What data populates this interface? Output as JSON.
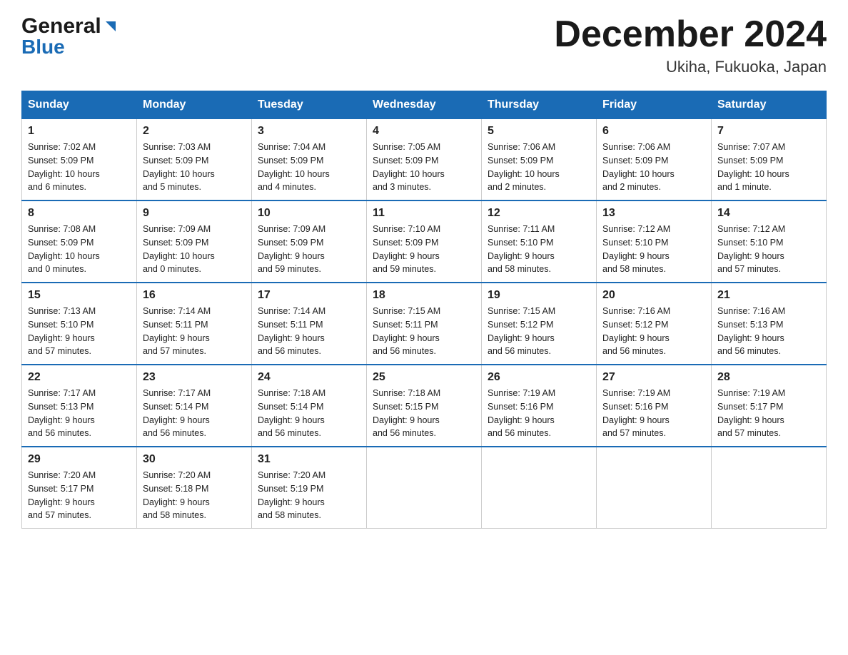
{
  "header": {
    "logo_line1": "General",
    "logo_line2": "Blue",
    "title": "December 2024",
    "subtitle": "Ukiha, Fukuoka, Japan"
  },
  "columns": [
    "Sunday",
    "Monday",
    "Tuesday",
    "Wednesday",
    "Thursday",
    "Friday",
    "Saturday"
  ],
  "weeks": [
    [
      {
        "day": "1",
        "info": "Sunrise: 7:02 AM\nSunset: 5:09 PM\nDaylight: 10 hours\nand 6 minutes."
      },
      {
        "day": "2",
        "info": "Sunrise: 7:03 AM\nSunset: 5:09 PM\nDaylight: 10 hours\nand 5 minutes."
      },
      {
        "day": "3",
        "info": "Sunrise: 7:04 AM\nSunset: 5:09 PM\nDaylight: 10 hours\nand 4 minutes."
      },
      {
        "day": "4",
        "info": "Sunrise: 7:05 AM\nSunset: 5:09 PM\nDaylight: 10 hours\nand 3 minutes."
      },
      {
        "day": "5",
        "info": "Sunrise: 7:06 AM\nSunset: 5:09 PM\nDaylight: 10 hours\nand 2 minutes."
      },
      {
        "day": "6",
        "info": "Sunrise: 7:06 AM\nSunset: 5:09 PM\nDaylight: 10 hours\nand 2 minutes."
      },
      {
        "day": "7",
        "info": "Sunrise: 7:07 AM\nSunset: 5:09 PM\nDaylight: 10 hours\nand 1 minute."
      }
    ],
    [
      {
        "day": "8",
        "info": "Sunrise: 7:08 AM\nSunset: 5:09 PM\nDaylight: 10 hours\nand 0 minutes."
      },
      {
        "day": "9",
        "info": "Sunrise: 7:09 AM\nSunset: 5:09 PM\nDaylight: 10 hours\nand 0 minutes."
      },
      {
        "day": "10",
        "info": "Sunrise: 7:09 AM\nSunset: 5:09 PM\nDaylight: 9 hours\nand 59 minutes."
      },
      {
        "day": "11",
        "info": "Sunrise: 7:10 AM\nSunset: 5:09 PM\nDaylight: 9 hours\nand 59 minutes."
      },
      {
        "day": "12",
        "info": "Sunrise: 7:11 AM\nSunset: 5:10 PM\nDaylight: 9 hours\nand 58 minutes."
      },
      {
        "day": "13",
        "info": "Sunrise: 7:12 AM\nSunset: 5:10 PM\nDaylight: 9 hours\nand 58 minutes."
      },
      {
        "day": "14",
        "info": "Sunrise: 7:12 AM\nSunset: 5:10 PM\nDaylight: 9 hours\nand 57 minutes."
      }
    ],
    [
      {
        "day": "15",
        "info": "Sunrise: 7:13 AM\nSunset: 5:10 PM\nDaylight: 9 hours\nand 57 minutes."
      },
      {
        "day": "16",
        "info": "Sunrise: 7:14 AM\nSunset: 5:11 PM\nDaylight: 9 hours\nand 57 minutes."
      },
      {
        "day": "17",
        "info": "Sunrise: 7:14 AM\nSunset: 5:11 PM\nDaylight: 9 hours\nand 56 minutes."
      },
      {
        "day": "18",
        "info": "Sunrise: 7:15 AM\nSunset: 5:11 PM\nDaylight: 9 hours\nand 56 minutes."
      },
      {
        "day": "19",
        "info": "Sunrise: 7:15 AM\nSunset: 5:12 PM\nDaylight: 9 hours\nand 56 minutes."
      },
      {
        "day": "20",
        "info": "Sunrise: 7:16 AM\nSunset: 5:12 PM\nDaylight: 9 hours\nand 56 minutes."
      },
      {
        "day": "21",
        "info": "Sunrise: 7:16 AM\nSunset: 5:13 PM\nDaylight: 9 hours\nand 56 minutes."
      }
    ],
    [
      {
        "day": "22",
        "info": "Sunrise: 7:17 AM\nSunset: 5:13 PM\nDaylight: 9 hours\nand 56 minutes."
      },
      {
        "day": "23",
        "info": "Sunrise: 7:17 AM\nSunset: 5:14 PM\nDaylight: 9 hours\nand 56 minutes."
      },
      {
        "day": "24",
        "info": "Sunrise: 7:18 AM\nSunset: 5:14 PM\nDaylight: 9 hours\nand 56 minutes."
      },
      {
        "day": "25",
        "info": "Sunrise: 7:18 AM\nSunset: 5:15 PM\nDaylight: 9 hours\nand 56 minutes."
      },
      {
        "day": "26",
        "info": "Sunrise: 7:19 AM\nSunset: 5:16 PM\nDaylight: 9 hours\nand 56 minutes."
      },
      {
        "day": "27",
        "info": "Sunrise: 7:19 AM\nSunset: 5:16 PM\nDaylight: 9 hours\nand 57 minutes."
      },
      {
        "day": "28",
        "info": "Sunrise: 7:19 AM\nSunset: 5:17 PM\nDaylight: 9 hours\nand 57 minutes."
      }
    ],
    [
      {
        "day": "29",
        "info": "Sunrise: 7:20 AM\nSunset: 5:17 PM\nDaylight: 9 hours\nand 57 minutes."
      },
      {
        "day": "30",
        "info": "Sunrise: 7:20 AM\nSunset: 5:18 PM\nDaylight: 9 hours\nand 58 minutes."
      },
      {
        "day": "31",
        "info": "Sunrise: 7:20 AM\nSunset: 5:19 PM\nDaylight: 9 hours\nand 58 minutes."
      },
      null,
      null,
      null,
      null
    ]
  ]
}
